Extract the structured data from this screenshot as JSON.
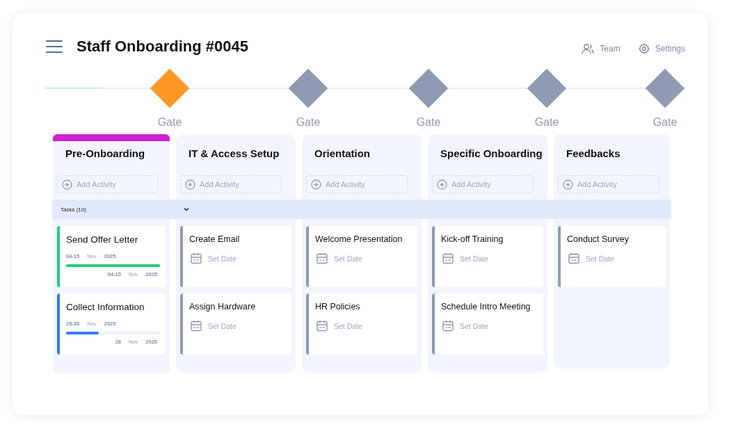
{
  "header": {
    "title": "Staff Onboarding #0045",
    "actions": [
      {
        "label": "Team",
        "kind": "team"
      },
      {
        "label": "Settings",
        "kind": "settings"
      }
    ]
  },
  "gates": [
    {
      "label": "Gate",
      "selected": true
    },
    {
      "label": "Gate",
      "selected": false
    },
    {
      "label": "Gate",
      "selected": false
    },
    {
      "label": "Gate",
      "selected": false
    },
    {
      "label": "Gate",
      "selected": false
    }
  ],
  "tasks_bar": {
    "label": "Tasks (10)",
    "expanded": true
  },
  "columns": [
    {
      "title": "Pre-Onboarding",
      "selected": true,
      "add_label": "Add Activity",
      "tasks": [
        {
          "kind": "dated",
          "title": "Send Offer Letter",
          "color": "#22cc77",
          "level": 1,
          "start": {
            "day": "04-15",
            "month": "Nov",
            "year": "2025"
          },
          "end": {
            "day": "04-15",
            "month": "Nov",
            "year": "2025"
          }
        },
        {
          "kind": "dated",
          "title": "Collect Information",
          "color": "#2f7bf5",
          "level": 0.35,
          "start": {
            "day": "25-30",
            "month": "Nov",
            "year": "2025"
          },
          "end": {
            "day": "28",
            "month": "Nov",
            "year": "2025"
          }
        }
      ]
    },
    {
      "title": "IT & Access Setup",
      "selected": false,
      "add_label": "Add Activity",
      "tasks": [
        {
          "kind": "undated",
          "title": "Create Email",
          "color": "#8f9bb3",
          "date_label": "Set Date"
        },
        {
          "kind": "undated",
          "title": "Assign Hardware",
          "color": "#8f9bb3",
          "date_label": "Set Date"
        }
      ]
    },
    {
      "title": "Orientation",
      "selected": false,
      "add_label": "Add Activity",
      "tasks": [
        {
          "kind": "undated",
          "title": "Welcome Presentation",
          "color": "#8f9bb3",
          "date_label": "Set Date"
        },
        {
          "kind": "undated",
          "title": "HR Policies",
          "color": "#8f9bb3",
          "date_label": "Set Date"
        }
      ]
    },
    {
      "title": "Specific Onboarding",
      "selected": false,
      "add_label": "Add Activity",
      "tasks": [
        {
          "kind": "undated",
          "title": "Kick-off Training",
          "color": "#8f9bb3",
          "date_label": "Set Date"
        },
        {
          "kind": "undated",
          "title": "Schedule Intro Meeting",
          "color": "#8f9bb3",
          "date_label": "Set Date"
        }
      ]
    },
    {
      "title": "Feedbacks",
      "selected": false,
      "add_label": "Add Activity",
      "tasks": [
        {
          "kind": "undated",
          "title": "Conduct Survey",
          "color": "#8f9bb3",
          "date_label": "Set Date"
        }
      ]
    }
  ]
}
